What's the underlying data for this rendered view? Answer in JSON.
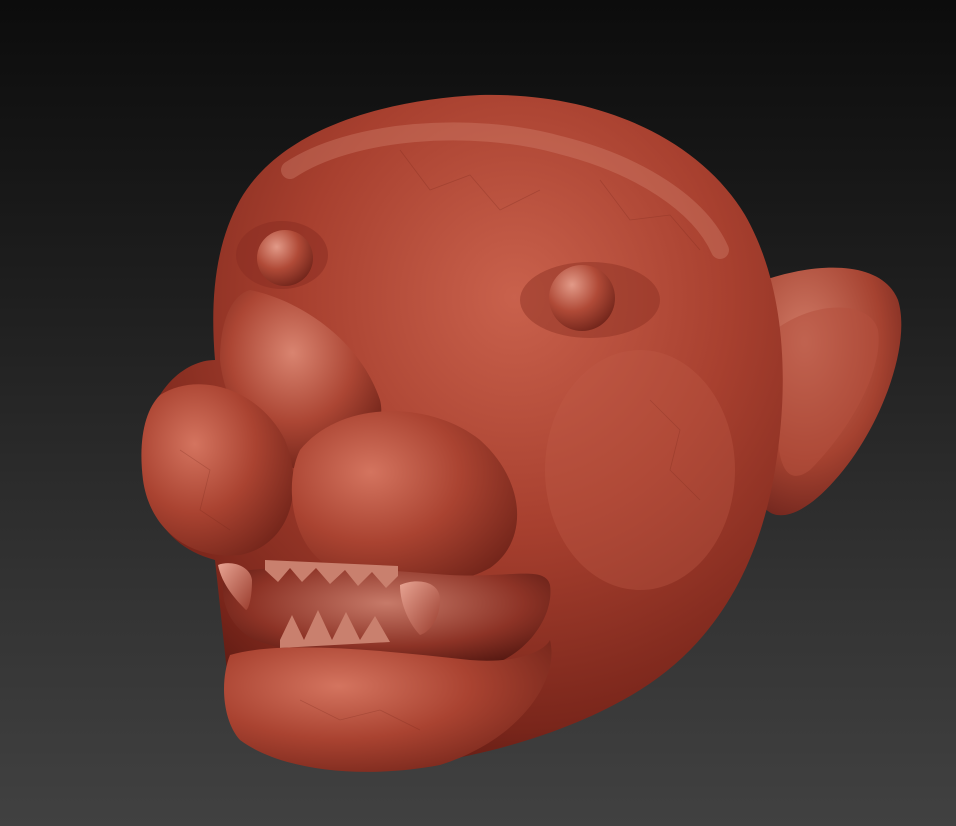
{
  "scene": {
    "subject": "sculpted-big-cat-head",
    "material_color": "#a8402f",
    "highlight_color": "#d98a78",
    "shadow_color": "#5a1a12",
    "background_top": "#0c0c0c",
    "background_bottom": "#414141"
  }
}
